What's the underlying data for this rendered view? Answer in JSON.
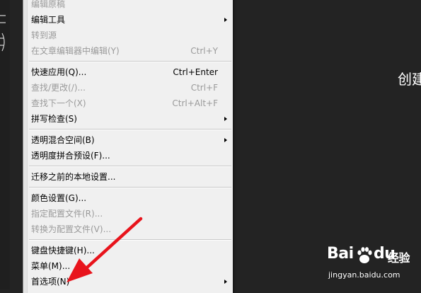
{
  "menu": {
    "items": [
      {
        "label": "编辑原稿",
        "shortcut": "",
        "disabled": true,
        "submenu": false
      },
      {
        "label": "编辑工具",
        "shortcut": "",
        "disabled": false,
        "submenu": true
      },
      {
        "label": "转到源",
        "shortcut": "",
        "disabled": true,
        "submenu": false
      },
      {
        "label": "在文章编辑器中编辑(Y)",
        "shortcut": "Ctrl+Y",
        "disabled": true,
        "submenu": false
      },
      {
        "label": "快速应用(Q)...",
        "shortcut": "Ctrl+Enter",
        "disabled": false,
        "submenu": false
      },
      {
        "label": "查找/更改(/)...",
        "shortcut": "Ctrl+F",
        "disabled": true,
        "submenu": false
      },
      {
        "label": "查找下一个(X)",
        "shortcut": "Ctrl+Alt+F",
        "disabled": true,
        "submenu": false
      },
      {
        "label": "拼写检查(S)",
        "shortcut": "",
        "disabled": false,
        "submenu": true
      },
      {
        "label": "透明混合空间(B)",
        "shortcut": "",
        "disabled": false,
        "submenu": true
      },
      {
        "label": "透明度拼合预设(F)...",
        "shortcut": "",
        "disabled": false,
        "submenu": false
      },
      {
        "label": "迁移之前的本地设置...",
        "shortcut": "",
        "disabled": false,
        "submenu": false
      },
      {
        "label": "颜色设置(G)...",
        "shortcut": "",
        "disabled": false,
        "submenu": false
      },
      {
        "label": "指定配置文件(R)...",
        "shortcut": "",
        "disabled": true,
        "submenu": false
      },
      {
        "label": "转换为配置文件(V)...",
        "shortcut": "",
        "disabled": true,
        "submenu": false
      },
      {
        "label": "键盘快捷键(H)...",
        "shortcut": "",
        "disabled": false,
        "submenu": false
      },
      {
        "label": "菜单(M)...",
        "shortcut": "",
        "disabled": false,
        "submenu": false
      },
      {
        "label": "首选项(N)",
        "shortcut": "",
        "disabled": false,
        "submenu": true
      }
    ]
  },
  "background": {
    "right_text": "创建"
  },
  "watermark": {
    "logo_bai": "Bai",
    "logo_du": "du",
    "logo_suffix": "经验",
    "url": "jingyan.baidu.com"
  },
  "colors": {
    "menu_bg": "#f0f0f0",
    "disabled_text": "#9a9a9a",
    "annotation_arrow": "#e8141c",
    "workspace_bg": "#232323"
  }
}
